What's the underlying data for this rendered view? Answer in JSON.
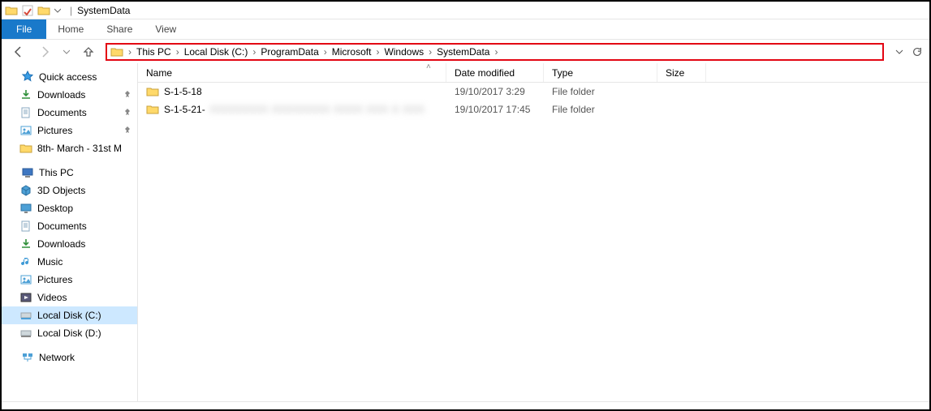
{
  "title": "SystemData",
  "ribbon_tabs": {
    "file": "File",
    "home": "Home",
    "share": "Share",
    "view": "View"
  },
  "breadcrumb": {
    "items": [
      "This PC",
      "Local Disk (C:)",
      "ProgramData",
      "Microsoft",
      "Windows",
      "SystemData"
    ]
  },
  "sidebar": {
    "quick_access": {
      "label": "Quick access",
      "items": [
        {
          "label": "Downloads",
          "pinned": true,
          "icon": "downloads"
        },
        {
          "label": "Documents",
          "pinned": true,
          "icon": "documents"
        },
        {
          "label": "Pictures",
          "pinned": true,
          "icon": "pictures"
        },
        {
          "label": "8th- March - 31st M",
          "pinned": false,
          "icon": "folder"
        }
      ]
    },
    "this_pc": {
      "label": "This PC",
      "items": [
        {
          "label": "3D Objects",
          "icon": "3dobjects"
        },
        {
          "label": "Desktop",
          "icon": "desktop"
        },
        {
          "label": "Documents",
          "icon": "documents"
        },
        {
          "label": "Downloads",
          "icon": "downloads"
        },
        {
          "label": "Music",
          "icon": "music"
        },
        {
          "label": "Pictures",
          "icon": "pictures"
        },
        {
          "label": "Videos",
          "icon": "videos"
        },
        {
          "label": "Local Disk (C:)",
          "icon": "disk",
          "selected": true
        },
        {
          "label": "Local Disk (D:)",
          "icon": "disk"
        }
      ]
    },
    "network": {
      "label": "Network"
    }
  },
  "columns": {
    "name": "Name",
    "date_modified": "Date modified",
    "type": "Type",
    "size": "Size"
  },
  "files": [
    {
      "name": "S-1-5-18",
      "name_suffix_blurred": "",
      "date_modified": "19/10/2017 3:29",
      "type": "File folder",
      "size": ""
    },
    {
      "name": "S-1-5-21-",
      "name_suffix_blurred": "XXXXXXXX XXXXXXXX XXXX XXX X  XXX",
      "date_modified": "19/10/2017 17:45",
      "type": "File folder",
      "size": ""
    }
  ]
}
